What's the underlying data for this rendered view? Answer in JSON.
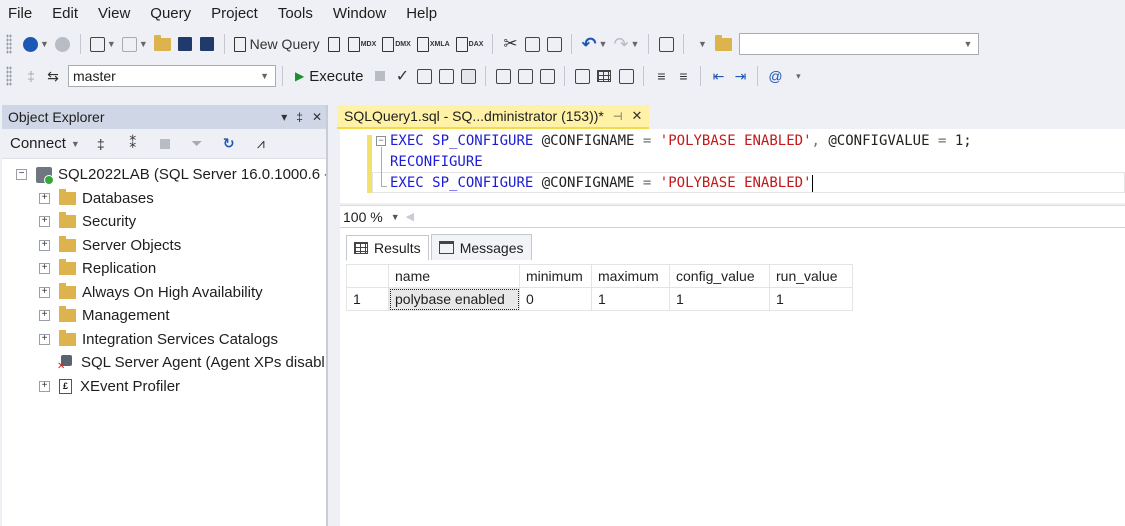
{
  "menu": [
    "File",
    "Edit",
    "View",
    "Query",
    "Project",
    "Tools",
    "Window",
    "Help"
  ],
  "toolbar": {
    "new_query_label": "New Query",
    "mdx_label": "MDX",
    "dmx_label": "DMX",
    "xmla_label": "XMLA",
    "dax_label": "DAX",
    "database": "master",
    "execute_label": "Execute"
  },
  "object_explorer": {
    "title": "Object Explorer",
    "pin_glyph": "▾ ‡ ✕",
    "connect_label": "Connect",
    "server": "SQL2022LAB (SQL Server 16.0.1000.6 - L",
    "nodes": [
      "Databases",
      "Security",
      "Server Objects",
      "Replication",
      "Always On High Availability",
      "Management",
      "Integration Services Catalogs"
    ],
    "agent": "SQL Server Agent (Agent XPs disabl",
    "xevent": "XEvent Profiler"
  },
  "tab": {
    "title": "SQLQuery1.sql - SQ...dministrator (153))*"
  },
  "editor": {
    "line1_kw1": "EXEC",
    "line1_proc": "SP_CONFIGURE",
    "line1_p1": "@CONFIGNAME",
    "line1_eq1": "=",
    "line1_str": "'POLYBASE ENABLED'",
    "line1_comma": ",",
    "line1_p2": "@CONFIGVALUE",
    "line1_eq2": "=",
    "line1_val": "1;",
    "line2_kw": "RECONFIGURE",
    "line3_kw1": "EXEC",
    "line3_proc": "SP_CONFIGURE",
    "line3_p1": "@CONFIGNAME",
    "line3_eq": "=",
    "line3_str": "'POLYBASE ENABLED'"
  },
  "zoom": "100 %",
  "results": {
    "tabs": [
      "Results",
      "Messages"
    ],
    "columns": [
      "name",
      "minimum",
      "maximum",
      "config_value",
      "run_value"
    ],
    "rows": [
      {
        "num": "1",
        "cells": [
          "polybase enabled",
          "0",
          "1",
          "1",
          "1"
        ]
      }
    ]
  }
}
